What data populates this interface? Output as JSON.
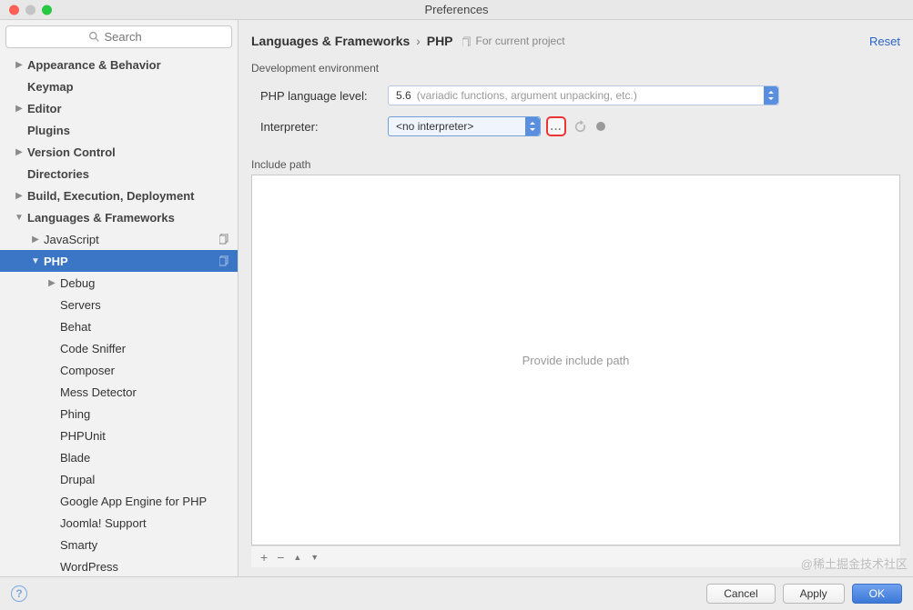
{
  "window": {
    "title": "Preferences"
  },
  "search": {
    "placeholder": "Search"
  },
  "sidebar": {
    "items": [
      {
        "label": "Appearance & Behavior",
        "bold": true,
        "expand": "right",
        "lvl": 0
      },
      {
        "label": "Keymap",
        "bold": true,
        "expand": "",
        "lvl": 0
      },
      {
        "label": "Editor",
        "bold": true,
        "expand": "right",
        "lvl": 0
      },
      {
        "label": "Plugins",
        "bold": true,
        "expand": "",
        "lvl": 0
      },
      {
        "label": "Version Control",
        "bold": true,
        "expand": "right",
        "lvl": 0
      },
      {
        "label": "Directories",
        "bold": true,
        "expand": "",
        "lvl": 0
      },
      {
        "label": "Build, Execution, Deployment",
        "bold": true,
        "expand": "right",
        "lvl": 0
      },
      {
        "label": "Languages & Frameworks",
        "bold": true,
        "expand": "down",
        "lvl": 0
      },
      {
        "label": "JavaScript",
        "bold": false,
        "expand": "right",
        "lvl": 1,
        "copy": true
      },
      {
        "label": "PHP",
        "bold": false,
        "expand": "down",
        "lvl": 1,
        "selected": true,
        "copy": true
      },
      {
        "label": "Debug",
        "bold": false,
        "expand": "right",
        "lvl": 2
      },
      {
        "label": "Servers",
        "bold": false,
        "expand": "",
        "lvl": 2
      },
      {
        "label": "Behat",
        "bold": false,
        "expand": "",
        "lvl": 2
      },
      {
        "label": "Code Sniffer",
        "bold": false,
        "expand": "",
        "lvl": 2
      },
      {
        "label": "Composer",
        "bold": false,
        "expand": "",
        "lvl": 2
      },
      {
        "label": "Mess Detector",
        "bold": false,
        "expand": "",
        "lvl": 2
      },
      {
        "label": "Phing",
        "bold": false,
        "expand": "",
        "lvl": 2
      },
      {
        "label": "PHPUnit",
        "bold": false,
        "expand": "",
        "lvl": 2
      },
      {
        "label": "Blade",
        "bold": false,
        "expand": "",
        "lvl": 2
      },
      {
        "label": "Drupal",
        "bold": false,
        "expand": "",
        "lvl": 2
      },
      {
        "label": "Google App Engine for PHP",
        "bold": false,
        "expand": "",
        "lvl": 2
      },
      {
        "label": "Joomla! Support",
        "bold": false,
        "expand": "",
        "lvl": 2
      },
      {
        "label": "Smarty",
        "bold": false,
        "expand": "",
        "lvl": 2
      },
      {
        "label": "WordPress",
        "bold": false,
        "expand": "",
        "lvl": 2
      }
    ]
  },
  "header": {
    "crumb1": "Languages & Frameworks",
    "crumb2": "PHP",
    "project_hint": "For current project",
    "reset": "Reset"
  },
  "form": {
    "section": "Development environment",
    "lang_label": "PHP language level:",
    "lang_value": "5.6",
    "lang_hint": "(variadic functions, argument unpacking, etc.)",
    "interp_label": "Interpreter:",
    "interp_value": "<no interpreter>",
    "browse": "...",
    "include_label": "Include path",
    "include_empty": "Provide include path"
  },
  "toolbar": {
    "add": "+",
    "remove": "−",
    "up": "▲",
    "down": "▼"
  },
  "footer": {
    "help": "?",
    "cancel": "Cancel",
    "apply": "Apply",
    "ok": "OK"
  },
  "watermark": "@稀土掘金技术社区"
}
